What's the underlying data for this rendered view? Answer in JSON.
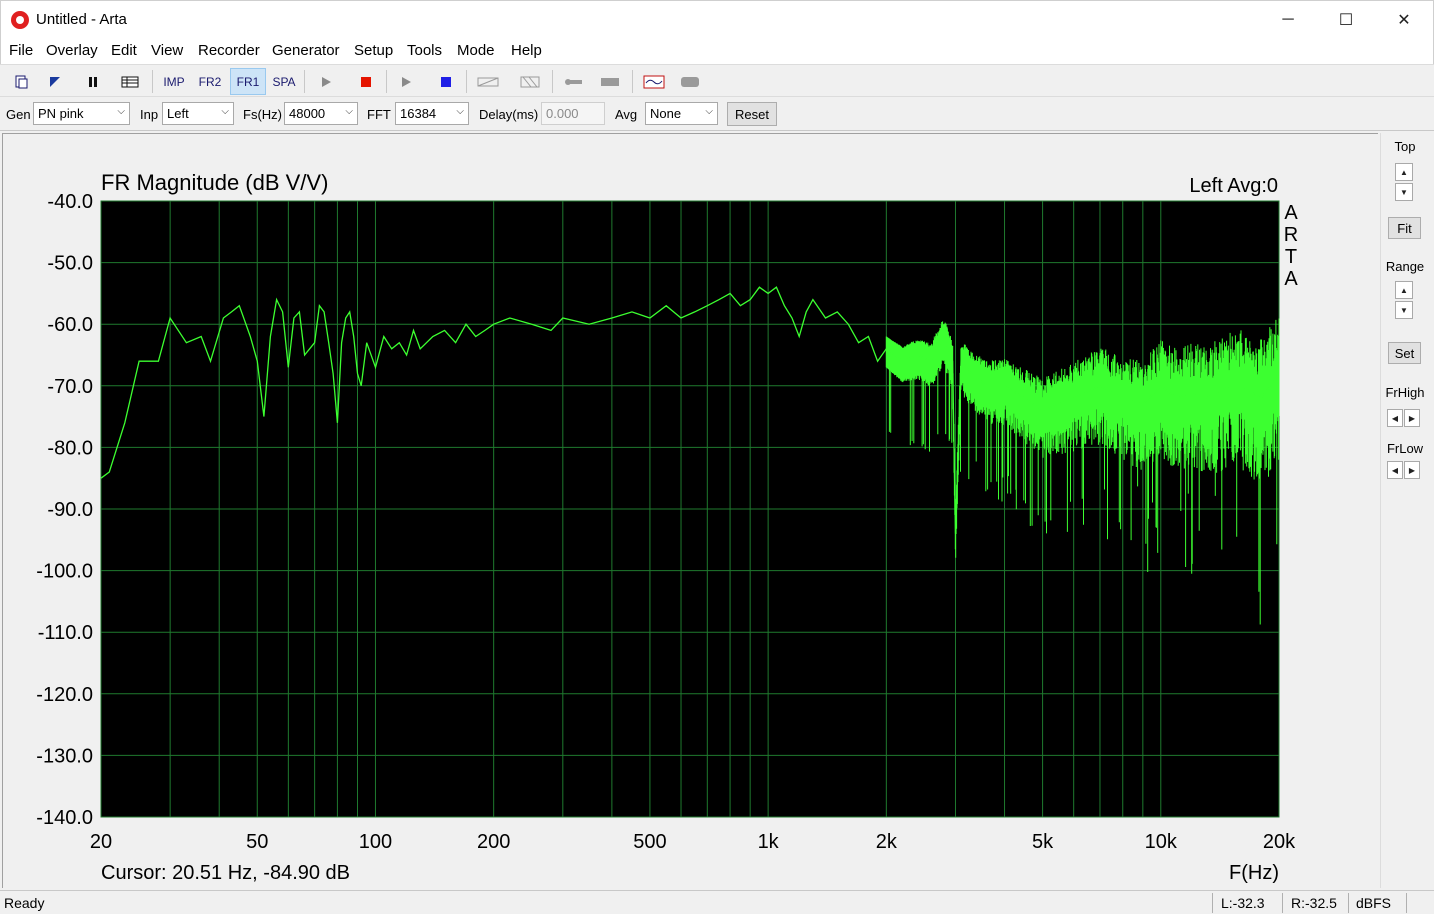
{
  "window": {
    "title": "Untitled - Arta",
    "controls": {
      "minimize": "─",
      "maximize": "☐",
      "close": "✕"
    }
  },
  "menu": [
    "File",
    "Overlay",
    "Edit",
    "View",
    "Recorder",
    "Generator",
    "Setup",
    "Tools",
    "Mode",
    "Help"
  ],
  "toolbar": {
    "imp": "IMP",
    "fr2": "FR2",
    "fr1": "FR1",
    "spa": "SPA",
    "active_mode": "FR1",
    "record_color": "#e51400",
    "stop_color": "#1f1fe6"
  },
  "controls": {
    "gen_label": "Gen",
    "gen_value": "PN pink",
    "inp_label": "Inp",
    "inp_value": "Left",
    "fs_label": "Fs(Hz)",
    "fs_value": "48000",
    "fft_label": "FFT",
    "fft_value": "16384",
    "delay_label": "Delay(ms)",
    "delay_value": "0.000",
    "avg_label": "Avg",
    "avg_value": "None",
    "reset_label": "Reset"
  },
  "side_panel": {
    "top_label": "Top",
    "fit_label": "Fit",
    "range_label": "Range",
    "set_label": "Set",
    "frhigh_label": "FrHigh",
    "frlow_label": "FrLow"
  },
  "chart_data": {
    "type": "line",
    "title": "FR Magnitude (dB V/V)",
    "channel_label": "Left  Avg:0",
    "brand_vertical": [
      "A",
      "R",
      "T",
      "A"
    ],
    "xlabel": "F(Hz)",
    "ylabel": "",
    "x_scale": "log",
    "xlim": [
      20,
      20000
    ],
    "ylim": [
      -140,
      -40
    ],
    "y_ticks": [
      "-40.0",
      "-50.0",
      "-60.0",
      "-70.0",
      "-80.0",
      "-90.0",
      "-100.0",
      "-110.0",
      "-120.0",
      "-130.0",
      "-140.0"
    ],
    "x_ticks": [
      {
        "value": 20,
        "label": "20"
      },
      {
        "value": 50,
        "label": "50"
      },
      {
        "value": 100,
        "label": "100"
      },
      {
        "value": 200,
        "label": "200"
      },
      {
        "value": 500,
        "label": "500"
      },
      {
        "value": 1000,
        "label": "1k"
      },
      {
        "value": 2000,
        "label": "2k"
      },
      {
        "value": 5000,
        "label": "5k"
      },
      {
        "value": 10000,
        "label": "10k"
      },
      {
        "value": 20000,
        "label": "20k"
      }
    ],
    "grid": true,
    "background_color": "#000000",
    "grid_color": "#1f7a2e",
    "line_color": "#3cff30",
    "cursor_text": "Cursor: 20.51 Hz, -84.90 dB",
    "series": [
      {
        "x": [
          20,
          21,
          23,
          25,
          28,
          30,
          33,
          36,
          38,
          41,
          43,
          45,
          48,
          50,
          52,
          54,
          56,
          58,
          60,
          62,
          64,
          66,
          70,
          72,
          74,
          76,
          78,
          80,
          82,
          84,
          86,
          88,
          90,
          92,
          95,
          100,
          105,
          110,
          115,
          120,
          125,
          130,
          140,
          150,
          160,
          170,
          180,
          190,
          200,
          220,
          250,
          280,
          300,
          350,
          400,
          450,
          500,
          550,
          600,
          650,
          700,
          750,
          800,
          850,
          900,
          950,
          1000,
          1050,
          1100,
          1150,
          1200,
          1250,
          1300,
          1400,
          1500,
          1600,
          1700,
          1800,
          1900,
          2000,
          2200,
          2400,
          2600,
          2800,
          2950,
          3000,
          3100,
          3300,
          3600,
          4000,
          4500,
          5000,
          6000,
          7000,
          8000,
          9000,
          10000,
          11000,
          12000,
          13000,
          14000,
          15000,
          16000,
          17000,
          18000,
          19000,
          20000
        ],
        "y": [
          -85,
          -84,
          -76,
          -66,
          -66,
          -59,
          -63,
          -62,
          -66,
          -59,
          -58,
          -57,
          -62,
          -66,
          -75,
          -62,
          -56,
          -58,
          -67,
          -59,
          -58,
          -65,
          -63,
          -57,
          -58,
          -63,
          -68,
          -76,
          -63,
          -59,
          -58,
          -62,
          -68,
          -70,
          -63,
          -67,
          -62,
          -64,
          -63,
          -65,
          -61,
          -64,
          -62,
          -61,
          -63,
          -60,
          -62,
          -61,
          -60,
          -59,
          -60,
          -61,
          -59,
          -60,
          -59,
          -58,
          -59,
          -57,
          -59,
          -58,
          -57,
          -56,
          -55,
          -57,
          -56,
          -54,
          -55,
          -54,
          -57,
          -59,
          -62,
          -58,
          -56,
          -59,
          -58,
          -60,
          -63,
          -62,
          -66,
          -64,
          -66,
          -65,
          -66,
          -62,
          -66,
          -94,
          -66,
          -68,
          -70,
          -70,
          -72,
          -74,
          -72,
          -70,
          -72,
          -73,
          -70,
          -72,
          -71,
          -72,
          -71,
          -70,
          -70,
          -71,
          -72,
          -70,
          -68
        ]
      }
    ]
  },
  "status": {
    "ready": "Ready",
    "left_level": "L:-32.3",
    "right_level": "R:-32.5",
    "unit": "dBFS"
  }
}
